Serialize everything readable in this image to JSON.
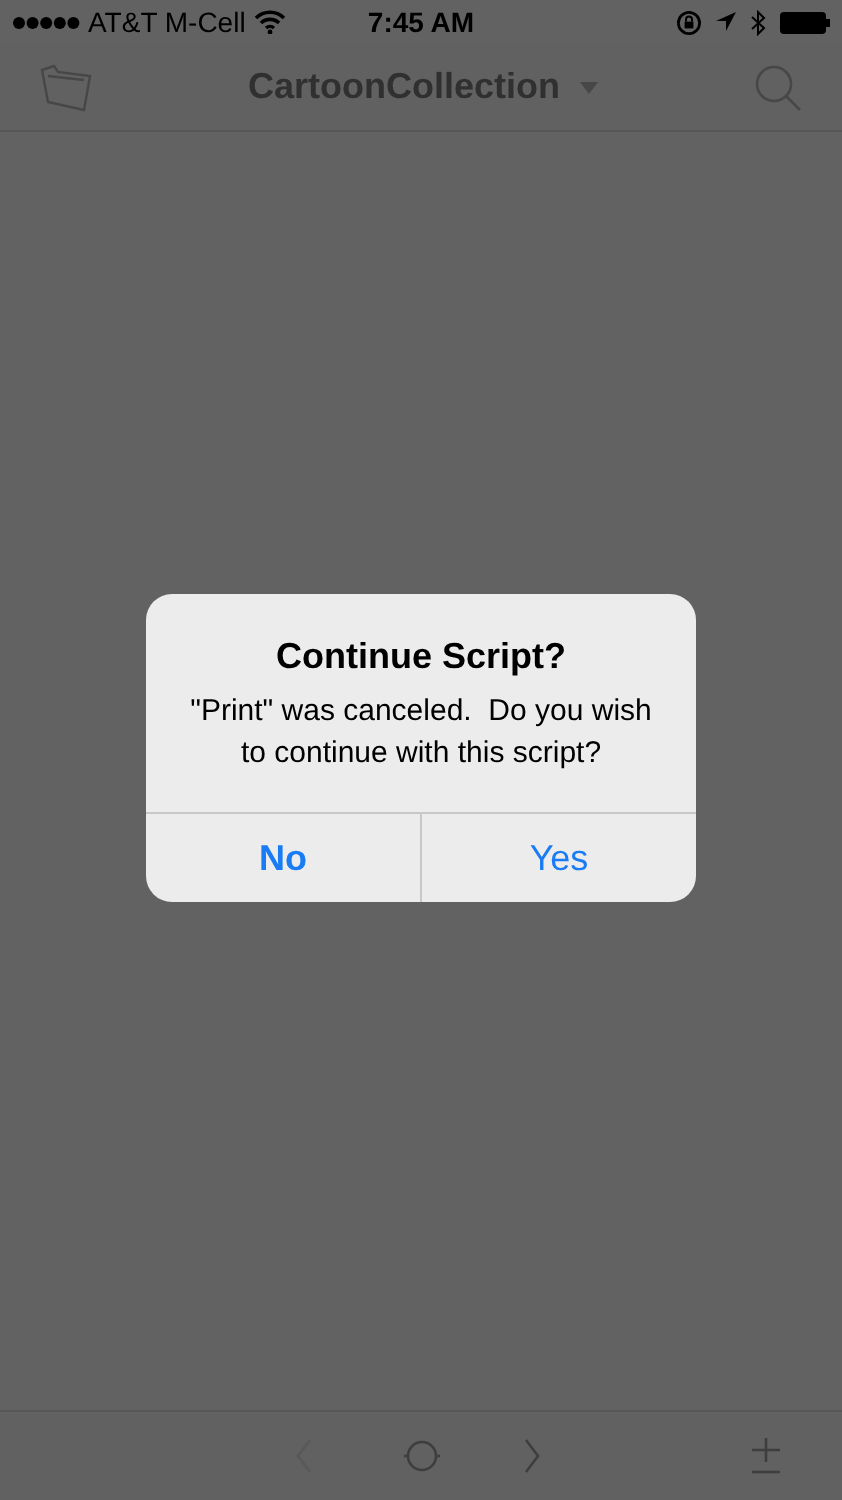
{
  "status_bar": {
    "carrier": "AT&T M-Cell",
    "time": "7:45 AM"
  },
  "nav_bar": {
    "title": "CartoonCollection"
  },
  "toolbar": {
    "buttons": [
      {
        "kind": "back",
        "disabled": true
      },
      {
        "kind": "home",
        "disabled": false
      },
      {
        "kind": "forward",
        "disabled": false
      },
      {
        "kind": "add-remove",
        "disabled": false
      }
    ]
  },
  "alert": {
    "title": "Continue Script?",
    "message": "\"Print\" was canceled.  Do you wish to continue with this script?",
    "buttons": [
      {
        "label": "No",
        "emphasized": true
      },
      {
        "label": "Yes",
        "emphasized": false
      }
    ]
  }
}
